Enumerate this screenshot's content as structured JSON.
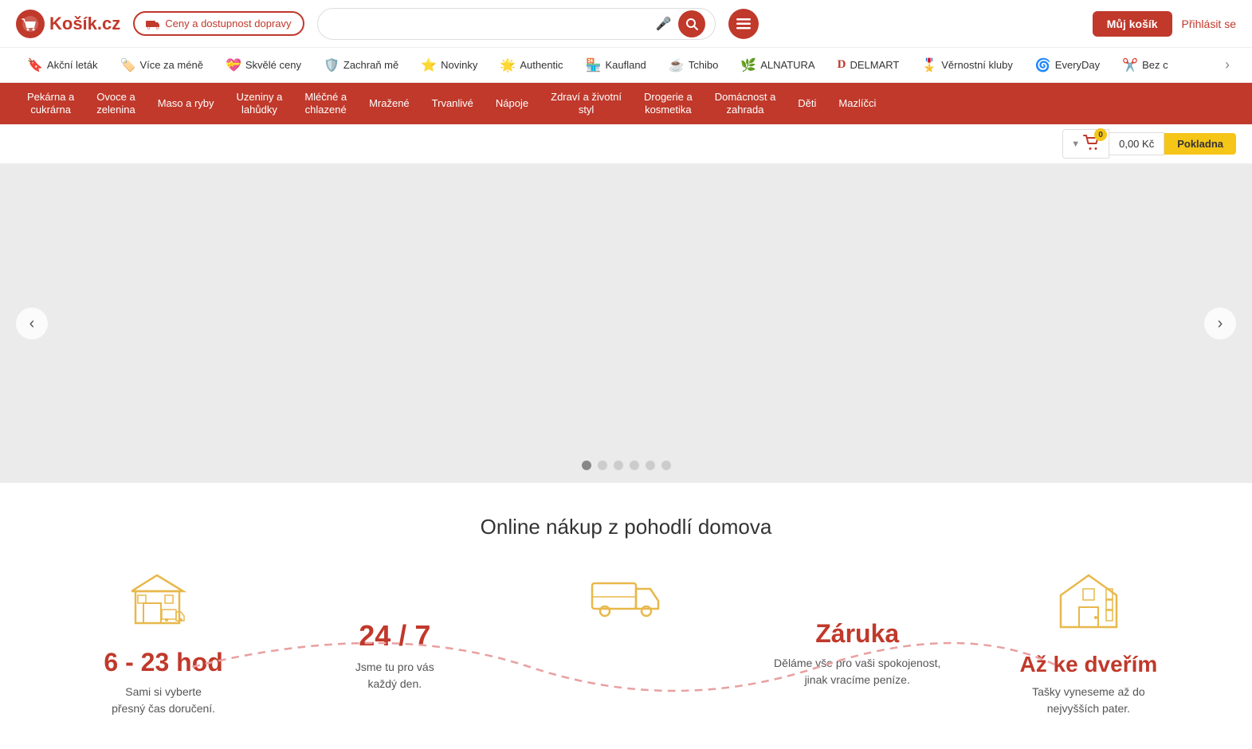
{
  "header": {
    "logo_text": "Košík.cz",
    "delivery_btn": "Ceny a dostupnost dopravy",
    "search_placeholder": "",
    "my_cart_label": "Můj košík",
    "login_label": "Přihlásit se"
  },
  "promo_bar": {
    "items": [
      {
        "id": "akcni-letak",
        "icon": "🔖",
        "label": "Akční leták"
      },
      {
        "id": "vice-za-mene",
        "icon": "🏷️",
        "label": "Více za méně"
      },
      {
        "id": "skvele-ceny",
        "icon": "💝",
        "label": "Skvělé ceny"
      },
      {
        "id": "zachran-me",
        "icon": "🛡️",
        "label": "Zachraň mě"
      },
      {
        "id": "novinky",
        "icon": "⭐",
        "label": "Novinky"
      },
      {
        "id": "authentic",
        "icon": "🌟",
        "label": "Authentic"
      },
      {
        "id": "kaufland",
        "icon": "🏪",
        "label": "Kaufland"
      },
      {
        "id": "tchibo",
        "icon": "☕",
        "label": "Tchibo"
      },
      {
        "id": "alnatura",
        "icon": "🌿",
        "label": "ALNATURA"
      },
      {
        "id": "delmart",
        "icon": "🅳",
        "label": "DELMART"
      },
      {
        "id": "vernostni-kluby",
        "icon": "🎖️",
        "label": "Věrnostní kluby"
      },
      {
        "id": "everyday",
        "icon": "🌀",
        "label": "EveryDay"
      },
      {
        "id": "bez-c",
        "icon": "✂️",
        "label": "Bez c"
      }
    ]
  },
  "category_nav": {
    "items": [
      {
        "id": "pekarna",
        "label": "Pekárna a\ncukrárna"
      },
      {
        "id": "ovoce",
        "label": "Ovoce a\nzelenina"
      },
      {
        "id": "maso",
        "label": "Maso a ryby"
      },
      {
        "id": "uzeniny",
        "label": "Uzeniny a\nlahůdky"
      },
      {
        "id": "mlecne",
        "label": "Mléčné a\nchlazené"
      },
      {
        "id": "mrazene",
        "label": "Mražené"
      },
      {
        "id": "trvanive",
        "label": "Trvanlivé"
      },
      {
        "id": "napoje",
        "label": "Nápoje"
      },
      {
        "id": "zdravi",
        "label": "Zdraví a životní\nstyl"
      },
      {
        "id": "drogerie",
        "label": "Drogerie a\nkosmetika"
      },
      {
        "id": "domacnost",
        "label": "Domácnost a\nzahrada"
      },
      {
        "id": "deti",
        "label": "Děti"
      },
      {
        "id": "mazlicici",
        "label": "Mazlíčci"
      }
    ]
  },
  "cart": {
    "badge_count": "0",
    "total": "0,00 Kč",
    "checkout_label": "Pokladna"
  },
  "slider": {
    "dots_count": 6,
    "active_dot": 0
  },
  "info_section": {
    "title": "Online nákup z pohodlí domova",
    "cards": [
      {
        "id": "time",
        "heading": "6 - 23 hod",
        "text": "Sami si vyberte\npřesný čas doručení."
      },
      {
        "id": "availability",
        "heading": "24 / 7",
        "text": "Jsme tu pro vás\nkaždý den."
      },
      {
        "id": "guarantee",
        "heading": "Záruka",
        "text": "Děláme vše pro vaši spokojenost,\njinak vracíme peníze."
      },
      {
        "id": "door",
        "heading": "Až ke dveřím",
        "text": "Tašky vyneseme až do\nnejvyšších pater."
      }
    ]
  }
}
